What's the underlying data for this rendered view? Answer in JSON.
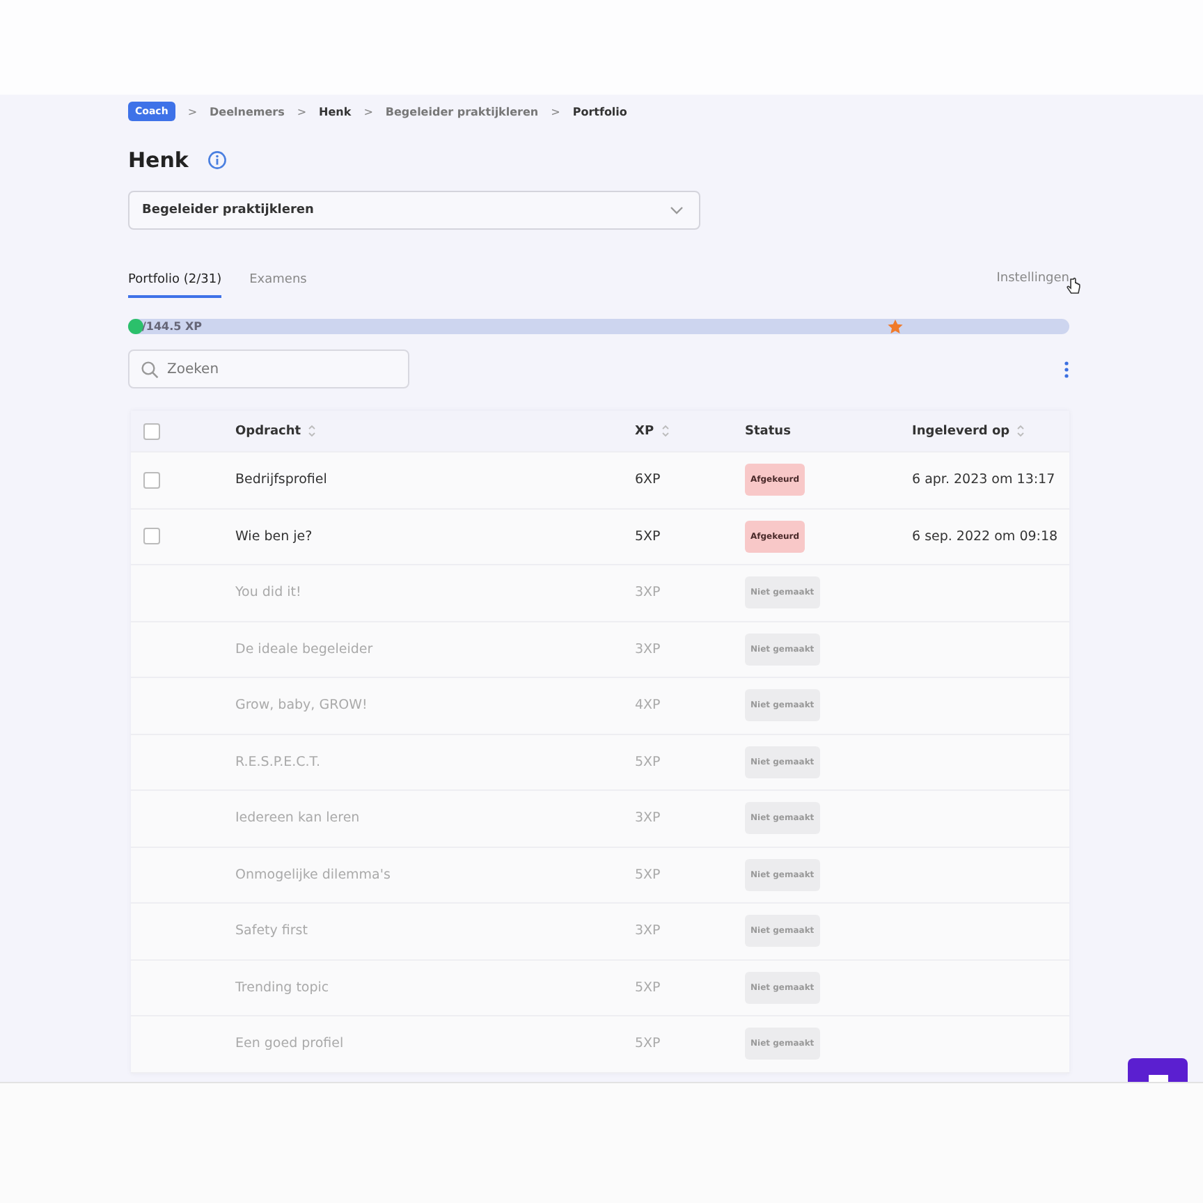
{
  "breadcrumb": {
    "badge": "Coach",
    "items": [
      {
        "separator": ">",
        "label": "Deelnemers",
        "current": false
      },
      {
        "separator": ">",
        "label": "Henk",
        "current": true
      },
      {
        "separator": ">",
        "label": "Begeleider praktijkleren",
        "current": false
      },
      {
        "separator": ">",
        "label": "Portfolio",
        "current": true
      }
    ]
  },
  "title": "Henk",
  "course_select": {
    "value": "Begeleider praktijkleren"
  },
  "tabs": [
    {
      "label": "Portfolio (2/31)",
      "selected": true
    },
    {
      "label": "Examens",
      "selected": false
    }
  ],
  "settings_link": "Instellingen",
  "progress": {
    "level": 0.0,
    "reading": "/144.5 XP"
  },
  "search": {
    "placeholder": "Zoeken"
  },
  "table": {
    "select_all": {
      "checked": false
    },
    "columns": [
      {
        "label": "Opdracht",
        "sortable": true
      },
      {
        "label": "XP",
        "sortable": true
      },
      {
        "label": "Status",
        "sortable": false
      },
      {
        "label": "Ingeleverd op",
        "sortable": true
      }
    ],
    "rows": [
      {
        "title": "Bedrijfsprofiel",
        "xp": "6XP",
        "status": "Afgekeurd",
        "kind": "rejected",
        "submitted": "6 apr. 2023 om 13:17",
        "disabled": false,
        "checked": false
      },
      {
        "title": "Wie ben je?",
        "xp": "5XP",
        "status": "Afgekeurd",
        "kind": "rejected",
        "submitted": "6 sep. 2022 om 09:18",
        "disabled": false,
        "checked": false
      },
      {
        "title": "You did it!",
        "xp": "3XP",
        "status": "Niet gemaakt",
        "kind": "not_made",
        "disabled": true
      },
      {
        "title": "De ideale begeleider",
        "xp": "3XP",
        "status": "Niet gemaakt",
        "kind": "not_made",
        "disabled": true
      },
      {
        "title": "Grow, baby, GROW!",
        "xp": "4XP",
        "status": "Niet gemaakt",
        "kind": "not_made",
        "disabled": true
      },
      {
        "title": "R.E.S.P.E.C.T.",
        "xp": "5XP",
        "status": "Niet gemaakt",
        "kind": "not_made",
        "disabled": true
      },
      {
        "title": "Iedereen kan leren",
        "xp": "3XP",
        "status": "Niet gemaakt",
        "kind": "not_made",
        "disabled": true
      },
      {
        "title": "Onmogelijke dilemma's",
        "xp": "5XP",
        "status": "Niet gemaakt",
        "kind": "not_made",
        "disabled": true
      },
      {
        "title": "Safety first",
        "xp": "3XP",
        "status": "Niet gemaakt",
        "kind": "not_made",
        "disabled": true
      },
      {
        "title": "Trending topic",
        "xp": "5XP",
        "status": "Niet gemaakt",
        "kind": "not_made",
        "disabled": true
      },
      {
        "title": "Een goed profiel",
        "xp": "5XP",
        "status": "Niet gemaakt",
        "kind": "not_made",
        "disabled": true
      }
    ]
  }
}
